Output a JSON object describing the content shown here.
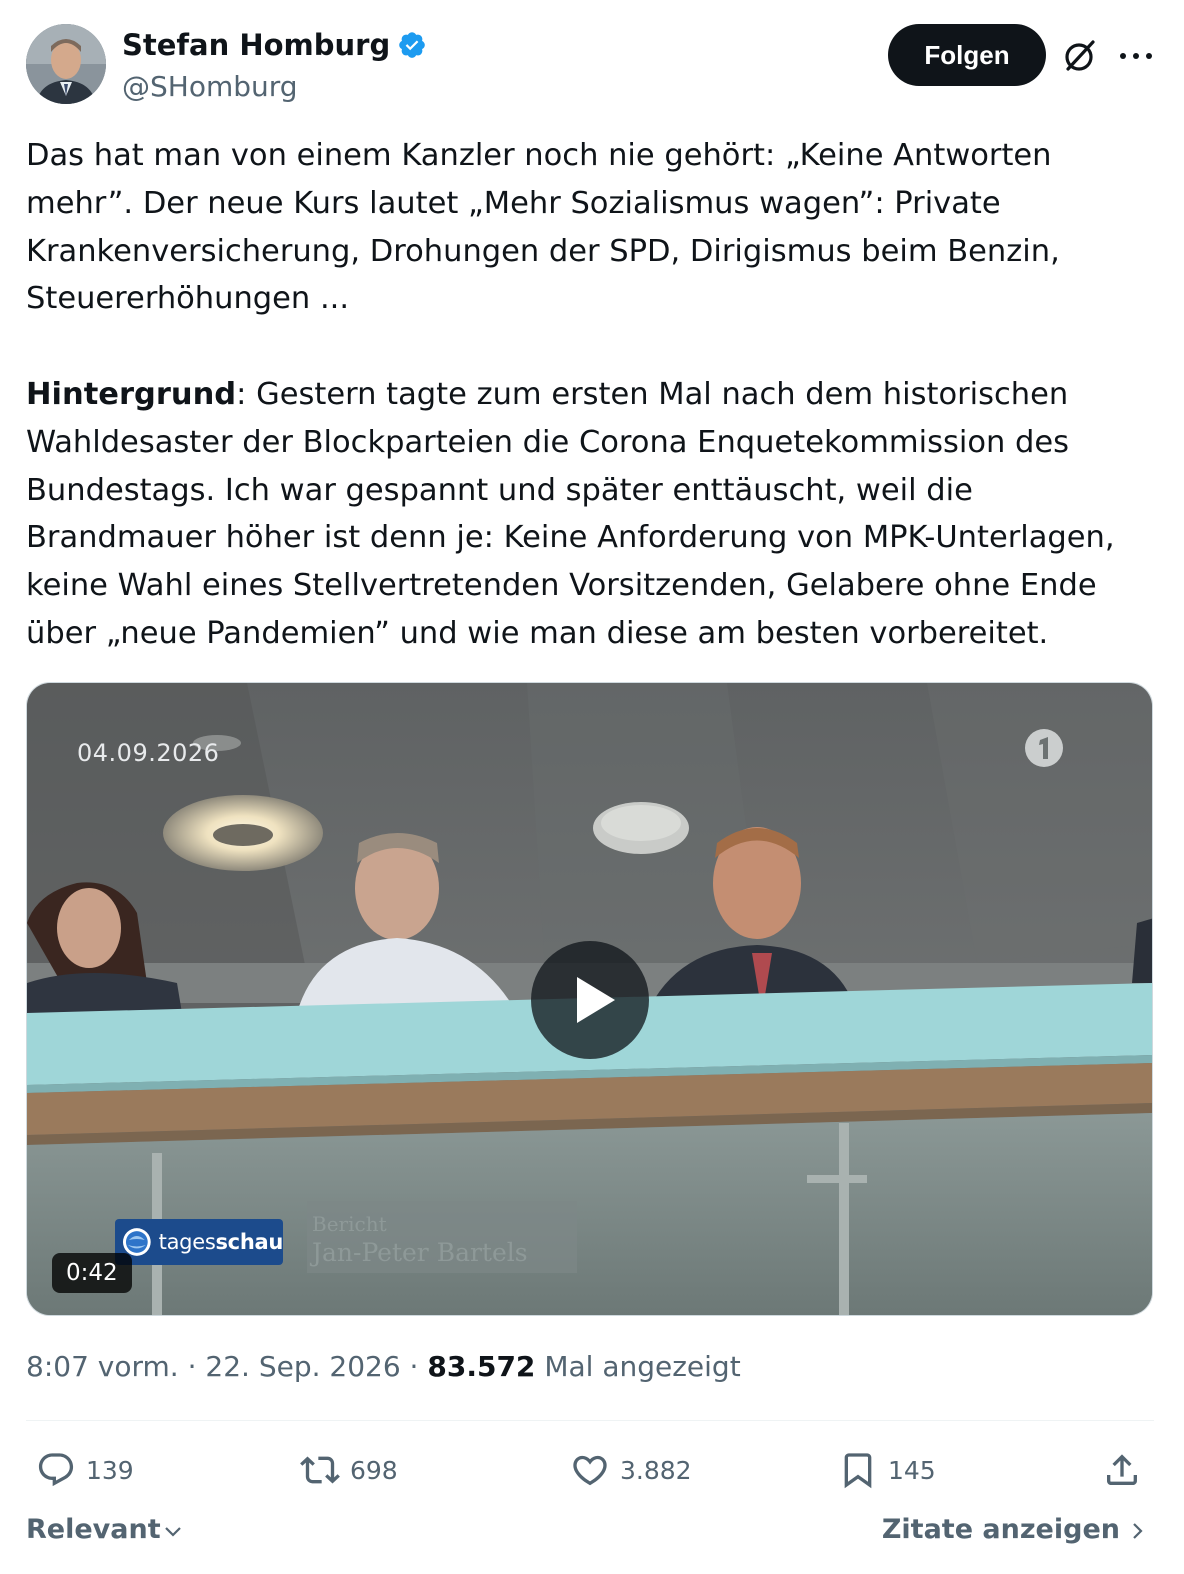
{
  "author": {
    "display_name": "Stefan Homburg",
    "handle": "@SHomburg",
    "verified": true
  },
  "header": {
    "follow_label": "Folgen",
    "grok_icon": "grok-icon",
    "more_icon": "more-icon"
  },
  "tweet": {
    "paragraph1": "Das hat man von einem Kanzler noch nie gehört: „Keine Antworten mehr”. Der neue Kurs lautet „Mehr Sozialismus wagen”: Private Krankenversicherung, Drohungen der SPD, Dirigismus beim Benzin, Steuererhöhungen ...",
    "paragraph2_bold": "Hintergrund",
    "paragraph2_rest": ": Gestern tagte zum ersten Mal nach dem historischen Wahldesaster der Blockparteien die Corona Enquetekommission des Bundestags. Ich war gespannt und später enttäuscht, weil die Brandmauer höher ist denn je: Keine Anforderung von MPK-Unterlagen, keine Wahl eines Stellvertretenden Vorsitzenden, Gelabere ohne Ende über „neue Pandemien” und wie man diese am besten vorbereitet."
  },
  "video": {
    "date_overlay": "04.09.2026",
    "badge_label_thin": "tages",
    "badge_label_bold": "schau",
    "caption_line1": "Bericht",
    "caption_line2": "Jan-Peter Bartels",
    "duration": "0:42"
  },
  "meta": {
    "time": "8:07 vorm.",
    "sep1": " · ",
    "date": "22. Sep. 2026",
    "sep2": " · ",
    "views": "83.572",
    "views_label": " Mal angezeigt"
  },
  "actions": {
    "replies": "139",
    "reposts": "698",
    "likes": "3.882",
    "bookmarks": "145"
  },
  "footer": {
    "sort_label": "Relevant",
    "quotes_label": "Zitate anzeigen"
  },
  "colors": {
    "text_primary": "#0f1419",
    "text_secondary": "#536471",
    "verified_blue": "#1d9bf0",
    "railing_cyan": "#9fd6d8"
  }
}
